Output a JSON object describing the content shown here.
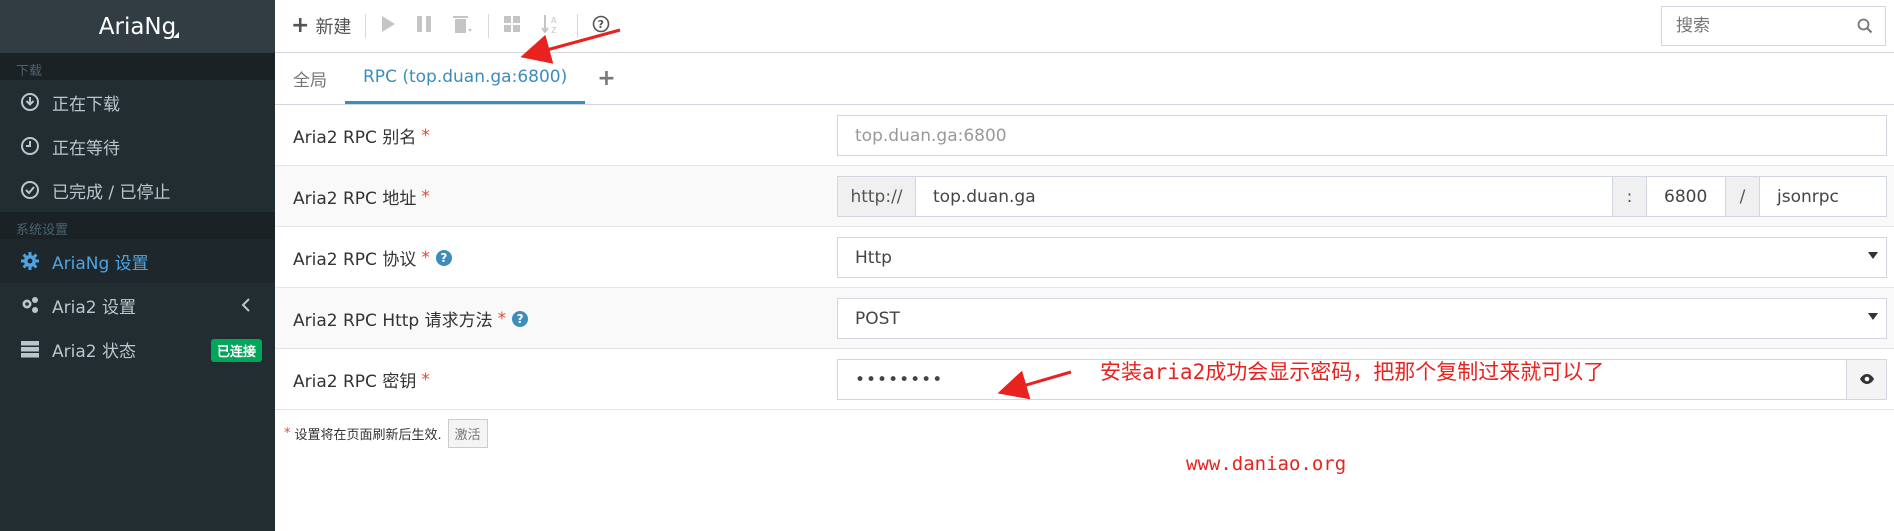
{
  "app": {
    "logo": "AriaNg"
  },
  "sidebar": {
    "section_download": "下载",
    "downloading": "正在下载",
    "waiting": "正在等待",
    "stopped": "已完成 / 已停止",
    "section_settings": "系统设置",
    "ariang_settings": "AriaNg 设置",
    "aria2_settings": "Aria2 设置",
    "aria2_status": "Aria2 状态",
    "status_badge": "已连接"
  },
  "toolbar": {
    "new_label": "新建",
    "search_placeholder": "搜索"
  },
  "tabs": {
    "global": "全局",
    "rpc": "RPC (top.duan.ga:6800)"
  },
  "form": {
    "alias_label": "Aria2 RPC 别名",
    "alias_placeholder": "top.duan.ga:6800",
    "address_label": "Aria2 RPC 地址",
    "address_scheme": "http://",
    "address_host": "top.duan.ga",
    "address_colon": ":",
    "address_port": "6800",
    "address_slash": "/",
    "address_path": "jsonrpc",
    "protocol_label": "Aria2 RPC 协议",
    "protocol_value": "Http",
    "method_label": "Aria2 RPC Http 请求方法",
    "method_value": "POST",
    "secret_label": "Aria2 RPC 密钥",
    "secret_value": "••••••••",
    "required_mark": "*"
  },
  "footer": {
    "note": "设置将在页面刷新后生效.",
    "activate_label": "激活"
  },
  "annotations": {
    "hint_prefix": "安装",
    "hint_mono": "aria2",
    "hint_suffix": "成功会显示密码，把那个复制过来就可以了",
    "url": "www.daniao.org"
  },
  "colors": {
    "sidebar_bg": "#222d32",
    "accent": "#3c8dbc",
    "success": "#00a65a",
    "required": "#dd4b39",
    "annotation": "#e8231f"
  }
}
